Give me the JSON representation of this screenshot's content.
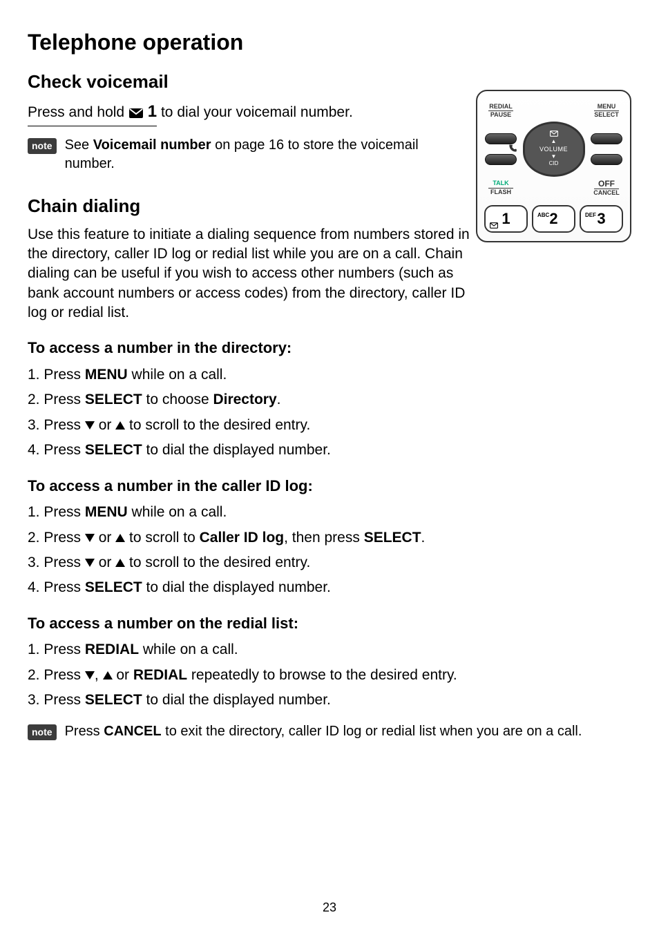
{
  "page_title": "Telephone operation",
  "sections": {
    "voicemail": {
      "heading": "Check voicemail",
      "line_prefix": "Press and hold",
      "line_key": "1",
      "line_suffix": " to dial your voicemail number.",
      "note_badge": "note",
      "note_pre": "See ",
      "note_bold": "Voicemail number",
      "note_post": " on page 16 to store the voicemail number."
    },
    "chain": {
      "heading": "Chain dialing",
      "body": "Use this feature to initiate a dialing sequence from numbers stored in the directory, caller ID log or redial list while you are on a call. Chain dialing can be useful if you wish to access other numbers (such as bank account numbers or access codes) from the directory, caller ID log or redial list."
    },
    "dir": {
      "heading": "To access a number in the directory:",
      "s1_a": "Press ",
      "s1_b": "MENU",
      "s1_c": " while on a call.",
      "s2_a": "Press ",
      "s2_b": "SELECT",
      "s2_c": " to choose ",
      "s2_d": "Directory",
      "s2_e": ".",
      "s3_a": "Press ",
      "s3_b": " or ",
      "s3_c": " to scroll to the desired entry.",
      "s4_a": "Press ",
      "s4_b": "SELECT",
      "s4_c": " to dial the displayed number."
    },
    "cid": {
      "heading": "To access a number in the caller ID log:",
      "s1_a": "Press ",
      "s1_b": "MENU",
      "s1_c": " while on a call.",
      "s2_a": "Press ",
      "s2_b": " or ",
      "s2_c": " to scroll to ",
      "s2_d": "Caller ID log",
      "s2_e": ", then press ",
      "s2_f": "SELECT",
      "s2_g": ".",
      "s3_a": "Press ",
      "s3_b": " or ",
      "s3_c": " to scroll to the desired entry.",
      "s4_a": "Press ",
      "s4_b": "SELECT",
      "s4_c": " to dial the displayed number."
    },
    "redial": {
      "heading": "To access a number on the redial list:",
      "s1_a": "Press ",
      "s1_b": "REDIAL",
      "s1_c": " while on a call.",
      "s2_a": "Press ",
      "s2_b": ", ",
      "s2_c": " or ",
      "s2_d": "REDIAL",
      "s2_e": " repeatedly to browse to the desired entry.",
      "s3_a": "Press ",
      "s3_b": "SELECT",
      "s3_c": " to dial the displayed number."
    },
    "end_note": {
      "badge": "note",
      "a": "Press ",
      "b": "CANCEL",
      "c": " to exit the directory, caller ID log or redial list when you are on a call."
    }
  },
  "keypad": {
    "redial": "REDIAL",
    "pause": "PAUSE",
    "menu": "MENU",
    "select": "SELECT",
    "talk": "TALK",
    "flash": "FLASH",
    "off": "OFF",
    "cancel": "CANCEL",
    "volume": "VOLUME",
    "cid": "CID",
    "d1": "1",
    "d2": "2",
    "d2sup": "ABC",
    "d3": "3",
    "d3sup": "DEF"
  },
  "page_number": "23"
}
